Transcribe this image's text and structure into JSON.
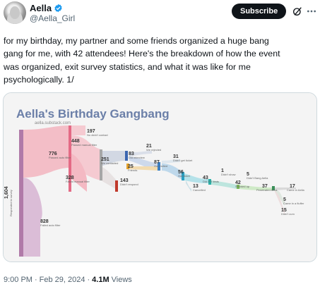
{
  "author": {
    "display_name": "Aella",
    "handle": "@Aella_Girl",
    "verified_color": "#1d9bf0"
  },
  "actions": {
    "subscribe_label": "Subscribe",
    "grok_icon": "grok-icon",
    "more_icon": "more-icon"
  },
  "tweet": {
    "line1": "for my birthday, my partner and some friends organized a huge bang",
    "line2": "gang for me, with 42 attendees! Here's the breakdown of how the event",
    "line3": "was organized, exit survey statistics, and what it was like for me",
    "line4": "psychologically. 1/"
  },
  "image": {
    "title": "Aella's Birthday Gangbang",
    "subtitle": "aella.substack.com",
    "nodes": [
      {
        "value": "1,604",
        "label": "Responded to survey"
      },
      {
        "value": "197",
        "label": "No didn't contact"
      },
      {
        "value": "448",
        "label": "Passed manual filter"
      },
      {
        "value": "776",
        "label": "Passed auto filter"
      },
      {
        "value": "328",
        "label": "Failed manual filter"
      },
      {
        "value": "828",
        "label": "Failed auto filter"
      },
      {
        "value": "251",
        "label": "We contacted"
      },
      {
        "value": "143",
        "label": "Didn't respond"
      },
      {
        "value": "83",
        "label": "Did interview"
      },
      {
        "value": "21",
        "label": "We rejected"
      },
      {
        "value": "25",
        "label": "Friends"
      },
      {
        "value": "87",
        "label": "Got invited"
      },
      {
        "value": "31",
        "label": "Didn't get ticket"
      },
      {
        "value": "56",
        "label": "Got ticket"
      },
      {
        "value": "13",
        "label": "Cancelled"
      },
      {
        "value": "43",
        "label": "Did STI tests"
      },
      {
        "value": "1",
        "label": "Didn't show"
      },
      {
        "value": "42",
        "label": "Showed up"
      },
      {
        "value": "5",
        "label": "Didn't Bang Aella"
      },
      {
        "value": "37",
        "label": "Penetrated Aella"
      },
      {
        "value": "17",
        "label": "Came in Aella"
      },
      {
        "value": "5",
        "label": "Came in a fluffer"
      },
      {
        "value": "15",
        "label": "Didn't cum"
      }
    ]
  },
  "meta": {
    "time": "9:00 PM",
    "sep1": "·",
    "date": "Feb 29, 2024",
    "sep2": "·",
    "views_count": "4.1M",
    "views_label": "Views"
  }
}
